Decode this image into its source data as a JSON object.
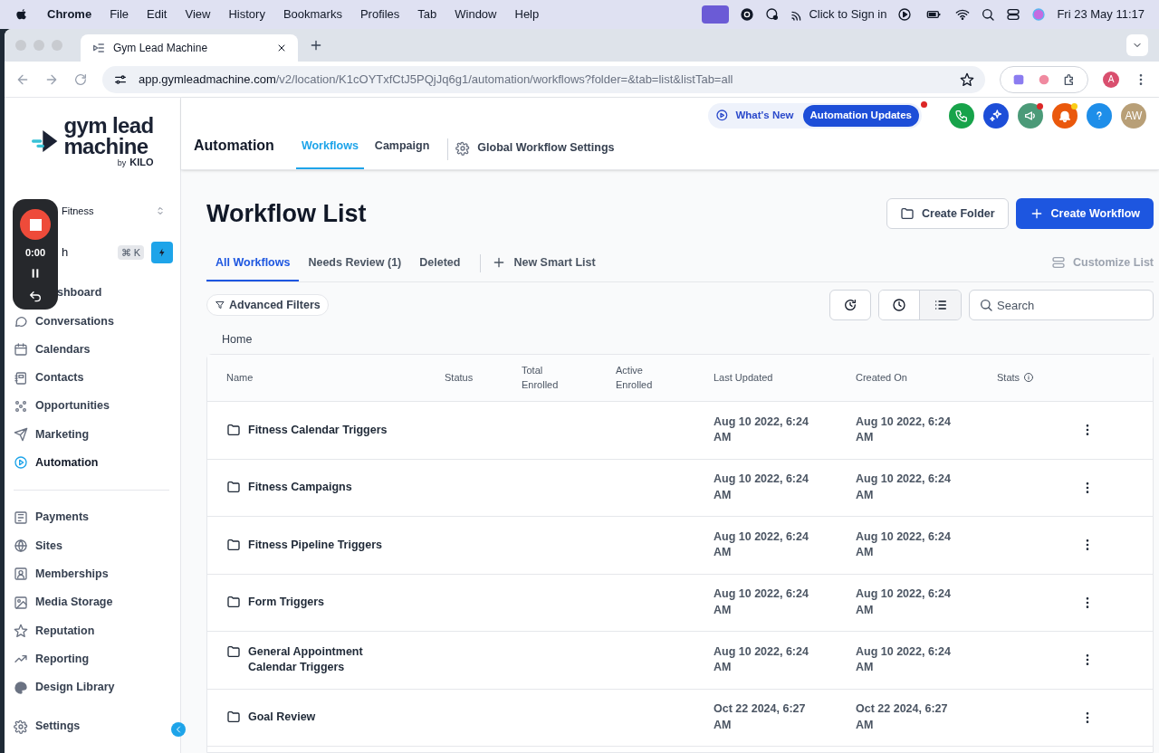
{
  "menubar": {
    "app": "Chrome",
    "menus": [
      "File",
      "Edit",
      "View",
      "History",
      "Bookmarks",
      "Profiles",
      "Tab",
      "Window",
      "Help"
    ],
    "sign_in": "Click to Sign in",
    "datetime": "Fri 23 May  11:17"
  },
  "browser": {
    "tab_title": "Gym Lead Machine",
    "url_host": "app.gymleadmachine.com",
    "url_path": "/v2/location/K1cOYTxfCtJ5PQjJq6g1/automation/workflows?folder=&tab=list&listTab=all",
    "profile": "A"
  },
  "recorder": {
    "time": "0:00"
  },
  "sidebar": {
    "logo_line1": "gym lead",
    "logo_line2": "machine",
    "logo_by": "by",
    "logo_brand": "KILO",
    "location": "Fitness",
    "search": "h",
    "shortcut": "⌘ K",
    "items": [
      {
        "label": "shboard",
        "selected": false
      },
      {
        "label": "Conversations",
        "selected": false
      },
      {
        "label": "Calendars",
        "selected": false
      },
      {
        "label": "Contacts",
        "selected": false
      },
      {
        "label": "Opportunities",
        "selected": false
      },
      {
        "label": "Marketing",
        "selected": false
      },
      {
        "label": "Automation",
        "selected": true
      },
      {
        "label": "Payments",
        "selected": false
      },
      {
        "label": "Sites",
        "selected": false
      },
      {
        "label": "Memberships",
        "selected": false
      },
      {
        "label": "Media Storage",
        "selected": false
      },
      {
        "label": "Reputation",
        "selected": false
      },
      {
        "label": "Reporting",
        "selected": false
      },
      {
        "label": "Design Library",
        "selected": false
      },
      {
        "label": "Settings",
        "selected": false
      }
    ]
  },
  "header": {
    "section": "Automation",
    "tabs": [
      {
        "label": "Workflows",
        "selected": true
      },
      {
        "label": "Campaign",
        "selected": false
      }
    ],
    "settings_link": "Global Workflow Settings",
    "whats_new": "What's New",
    "updates_badge": "Automation Updates",
    "avatar": "AW"
  },
  "page": {
    "title": "Workflow List",
    "create_folder": "Create Folder",
    "create_workflow": "Create Workflow",
    "list_tabs": [
      {
        "label": "All Workflows",
        "selected": true
      },
      {
        "label": "Needs Review (1)",
        "selected": false
      },
      {
        "label": "Deleted",
        "selected": false
      }
    ],
    "new_smart_list": "New Smart List",
    "customize_list": "Customize List",
    "advanced_filters": "Advanced Filters",
    "search_placeholder": "Search",
    "breadcrumb": "Home"
  },
  "table": {
    "columns": [
      "Name",
      "Status",
      "Total Enrolled",
      "Active Enrolled",
      "Last Updated",
      "Created On",
      "Stats"
    ],
    "rows": [
      {
        "name": "Fitness Calendar Triggers",
        "last_updated": "Aug 10 2022, 6:24 AM",
        "created_on": "Aug 10 2022, 6:24 AM"
      },
      {
        "name": "Fitness Campaigns",
        "last_updated": "Aug 10 2022, 6:24 AM",
        "created_on": "Aug 10 2022, 6:24 AM"
      },
      {
        "name": "Fitness Pipeline Triggers",
        "last_updated": "Aug 10 2022, 6:24 AM",
        "created_on": "Aug 10 2022, 6:24 AM"
      },
      {
        "name": "Form Triggers",
        "last_updated": "Aug 10 2022, 6:24 AM",
        "created_on": "Aug 10 2022, 6:24 AM"
      },
      {
        "name": "General Appointment Calendar Triggers",
        "last_updated": "Aug 10 2022, 6:24 AM",
        "created_on": "Aug 10 2022, 6:24 AM"
      },
      {
        "name": "Goal Review",
        "last_updated": "Oct 22 2024, 6:27 AM",
        "created_on": "Oct 22 2024, 6:27 AM"
      }
    ]
  }
}
